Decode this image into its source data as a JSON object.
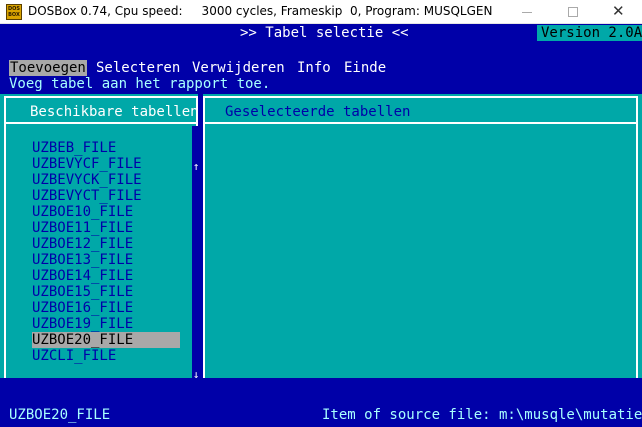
{
  "window": {
    "title": "DOSBox 0.74, Cpu speed:     3000 cycles, Frameskip  0, Program: MUSQLGEN",
    "icon_text": "DOS BOX",
    "close_glyph": "✕"
  },
  "header": {
    "title": ">> Tabel selectie <<",
    "version": "Version 2.0A"
  },
  "menu": {
    "items": [
      {
        "label": "Toevoegen",
        "active": true
      },
      {
        "label": "Selecteren",
        "active": false
      },
      {
        "label": "Verwijderen",
        "active": false
      },
      {
        "label": "Info",
        "active": false
      },
      {
        "label": "Einde",
        "active": false
      }
    ],
    "hint": "Voeg tabel aan het rapport toe."
  },
  "left_panel": {
    "title": "Beschikbare tabellen",
    "tables": [
      "UZBEB_FILE",
      "UZBEVYCF_FILE",
      "UZBEVYCK_FILE",
      "UZBEVYCT_FILE",
      "UZBOE10_FILE",
      "UZBOE11_FILE",
      "UZBOE12_FILE",
      "UZBOE13_FILE",
      "UZBOE14_FILE",
      "UZBOE15_FILE",
      "UZBOE16_FILE",
      "UZBOE19_FILE",
      "UZBOE20_FILE",
      "UZCLI_FILE"
    ],
    "selected_index": 12,
    "scroll_up_glyph": "↑",
    "scroll_down_glyph": "↓"
  },
  "right_panel": {
    "title": "Geselecteerde tabellen"
  },
  "status": {
    "current": "UZBOE20_FILE",
    "source": "Item of source file: m:\\musqle\\mutatie"
  },
  "colors": {
    "dos_blue": "#0000a8",
    "dos_cyan": "#00a8a8",
    "highlight_gray": "#a8a8a8",
    "light_cyan": "#a8ffff"
  }
}
